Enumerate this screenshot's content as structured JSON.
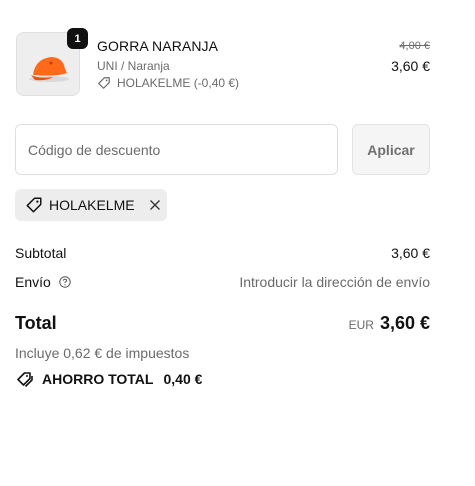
{
  "cart": {
    "items": [
      {
        "quantity": "1",
        "name": "GORRA NARANJA",
        "variant": "UNI / Naranja",
        "discount_label": "HOLAKELME (-0,40 €)",
        "original_price": "4,00 €",
        "price": "3,60 €",
        "image_color": "#ff6a1a"
      }
    ]
  },
  "discount": {
    "placeholder": "Código de descuento",
    "apply_label": "Aplicar",
    "applied_code": "HOLAKELME"
  },
  "summary": {
    "subtotal_label": "Subtotal",
    "subtotal_value": "3,60 €",
    "shipping_label": "Envío",
    "shipping_value": "Introducir la dirección de envío",
    "total_label": "Total",
    "currency": "EUR",
    "total_value": "3,60 €",
    "tax_note": "Incluye 0,62 € de impuestos",
    "savings_label": "AHORRO TOTAL",
    "savings_value": "0,40 €"
  }
}
